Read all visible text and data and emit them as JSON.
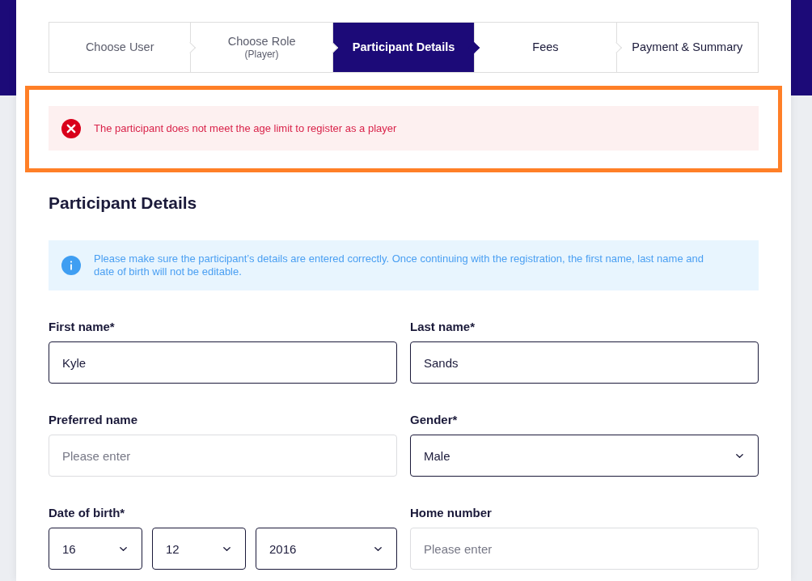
{
  "stepper": {
    "steps": [
      {
        "label": "Choose User",
        "selected": false,
        "completed": true
      },
      {
        "label": "Choose Role",
        "sublabel": "(Player)",
        "selected": false,
        "completed": true
      },
      {
        "label": "Participant Details",
        "selected": true,
        "completed": false
      },
      {
        "label": "Fees",
        "selected": false,
        "completed": false
      },
      {
        "label": "Payment & Summary",
        "selected": false,
        "completed": false
      }
    ]
  },
  "error_alert": {
    "message": "The participant does not meet the age limit to register as a player",
    "highlighted": true
  },
  "section": {
    "title": "Participant Details",
    "info_alert": {
      "message": "Please make sure the participant’s details are entered correctly. Once continuing with the registration, the first name, last name and date of birth will not be editable."
    },
    "fields": [
      {
        "kind": "text",
        "label": "First name*",
        "value": "Kyle"
      },
      {
        "kind": "text",
        "label": "Last name*",
        "value": "Sands"
      },
      {
        "kind": "text",
        "label": "Preferred name",
        "placeholder": "Please enter"
      },
      {
        "kind": "select",
        "label": "Gender*",
        "value": "Male"
      },
      {
        "kind": "date",
        "label": "Date of birth*",
        "parts": [
          "16",
          "12",
          "2016"
        ]
      },
      {
        "kind": "text",
        "label": "Home number",
        "placeholder": "Please enter"
      }
    ]
  }
}
